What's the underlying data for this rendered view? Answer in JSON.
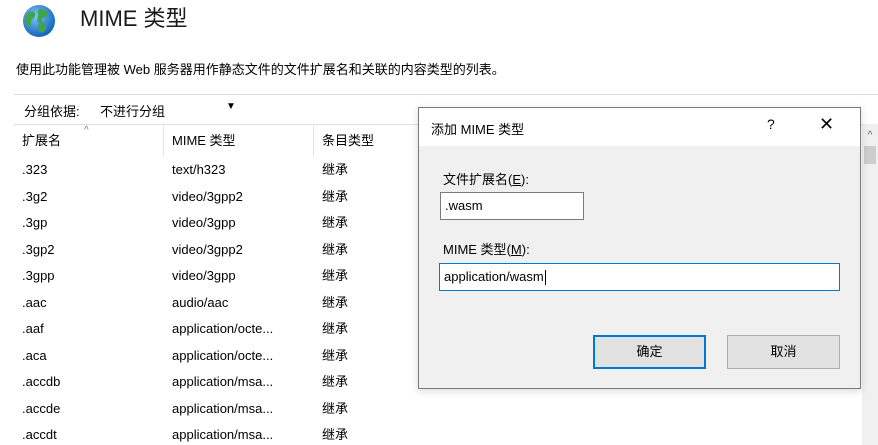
{
  "header": {
    "title": "MIME 类型",
    "description": "使用此功能管理被 Web 服务器用作静态文件的文件扩展名和关联的内容类型的列表。"
  },
  "groupbar": {
    "label": "分组依据:",
    "selected": "不进行分组"
  },
  "table": {
    "columns": [
      "扩展名",
      "MIME 类型",
      "条目类型"
    ],
    "rows": [
      [
        ".323",
        "text/h323",
        "继承"
      ],
      [
        ".3g2",
        "video/3gpp2",
        "继承"
      ],
      [
        ".3gp",
        "video/3gpp",
        "继承"
      ],
      [
        ".3gp2",
        "video/3gpp2",
        "继承"
      ],
      [
        ".3gpp",
        "video/3gpp",
        "继承"
      ],
      [
        ".aac",
        "audio/aac",
        "继承"
      ],
      [
        ".aaf",
        "application/octe...",
        "继承"
      ],
      [
        ".aca",
        "application/octe...",
        "继承"
      ],
      [
        ".accdb",
        "application/msa...",
        "继承"
      ],
      [
        ".accde",
        "application/msa...",
        "继承"
      ],
      [
        ".accdt",
        "application/msa...",
        "继承"
      ]
    ]
  },
  "dialog": {
    "title": "添加 MIME 类型",
    "help": "?",
    "close": "✕",
    "ext_label": "文件扩展名",
    "ext_mnemonic": "E",
    "ext_value": ".wasm",
    "mime_label": "MIME 类型",
    "mime_mnemonic": "M",
    "mime_value": "application/wasm",
    "ok_label": "确定",
    "cancel_label": "取消"
  },
  "colors": {
    "accent": "#0078d7",
    "dialog_bg": "#f0f0f0",
    "button_bg": "#e1e1e1"
  },
  "icons": {
    "header": "globe-icon"
  }
}
